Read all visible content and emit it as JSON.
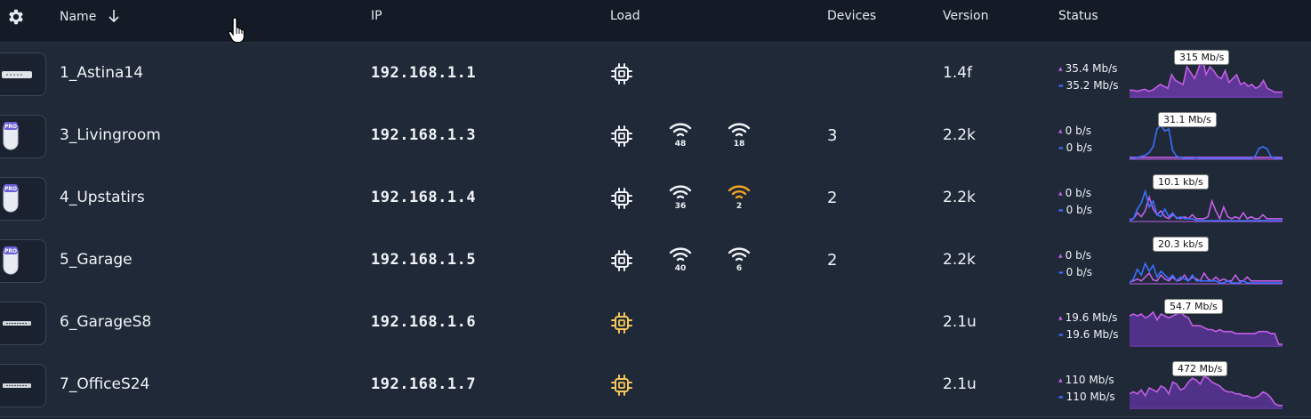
{
  "header": {
    "name": "Name",
    "ip": "IP",
    "load": "Load",
    "devices": "Devices",
    "version": "Version",
    "status": "Status"
  },
  "colors": {
    "accent_purple": "#c35ee8",
    "accent_blue": "#3b6fff",
    "warn_yellow": "#f5c75a",
    "warn_orange": "#f2a322"
  },
  "rows": [
    {
      "name": "1_Astina14",
      "ip": "192.168.1.1",
      "icon": "gateway-device-icon",
      "cpu_state": "normal",
      "wifi": [],
      "devices": "",
      "version": "1.4f",
      "up": "35.4 Mb/s",
      "down": "35.2 Mb/s",
      "peak": "315 Mb/s"
    },
    {
      "name": "3_Livingroom",
      "ip": "192.168.1.3",
      "icon": "access-point-pro-icon",
      "cpu_state": "normal",
      "wifi": [
        {
          "num": "48",
          "state": "normal"
        },
        {
          "num": "18",
          "state": "normal"
        }
      ],
      "devices": "3",
      "version": "2.2k",
      "up": "0 b/s",
      "down": "0 b/s",
      "peak": "31.1 Mb/s"
    },
    {
      "name": "4_Upstatirs",
      "ip": "192.168.1.4",
      "icon": "access-point-pro-icon",
      "cpu_state": "normal",
      "wifi": [
        {
          "num": "36",
          "state": "normal"
        },
        {
          "num": "2",
          "state": "warn"
        }
      ],
      "devices": "2",
      "version": "2.2k",
      "up": "0 b/s",
      "down": "0 b/s",
      "peak": "10.1 kb/s"
    },
    {
      "name": "5_Garage",
      "ip": "192.168.1.5",
      "icon": "access-point-pro-icon",
      "cpu_state": "normal",
      "wifi": [
        {
          "num": "40",
          "state": "normal"
        },
        {
          "num": "6",
          "state": "normal"
        }
      ],
      "devices": "2",
      "version": "2.2k",
      "up": "0 b/s",
      "down": "0 b/s",
      "peak": "20.3 kb/s"
    },
    {
      "name": "6_GarageS8",
      "ip": "192.168.1.6",
      "icon": "switch-device-icon",
      "cpu_state": "warn",
      "wifi": [],
      "devices": "",
      "version": "2.1u",
      "up": "19.6 Mb/s",
      "down": "19.6 Mb/s",
      "peak": "54.7 Mb/s"
    },
    {
      "name": "7_OfficeS24",
      "ip": "192.168.1.7",
      "icon": "switch-device-icon",
      "cpu_state": "warn",
      "wifi": [],
      "devices": "",
      "version": "2.1u",
      "up": "110 Mb/s",
      "down": "110 Mb/s",
      "peak": "472 Mb/s"
    }
  ]
}
